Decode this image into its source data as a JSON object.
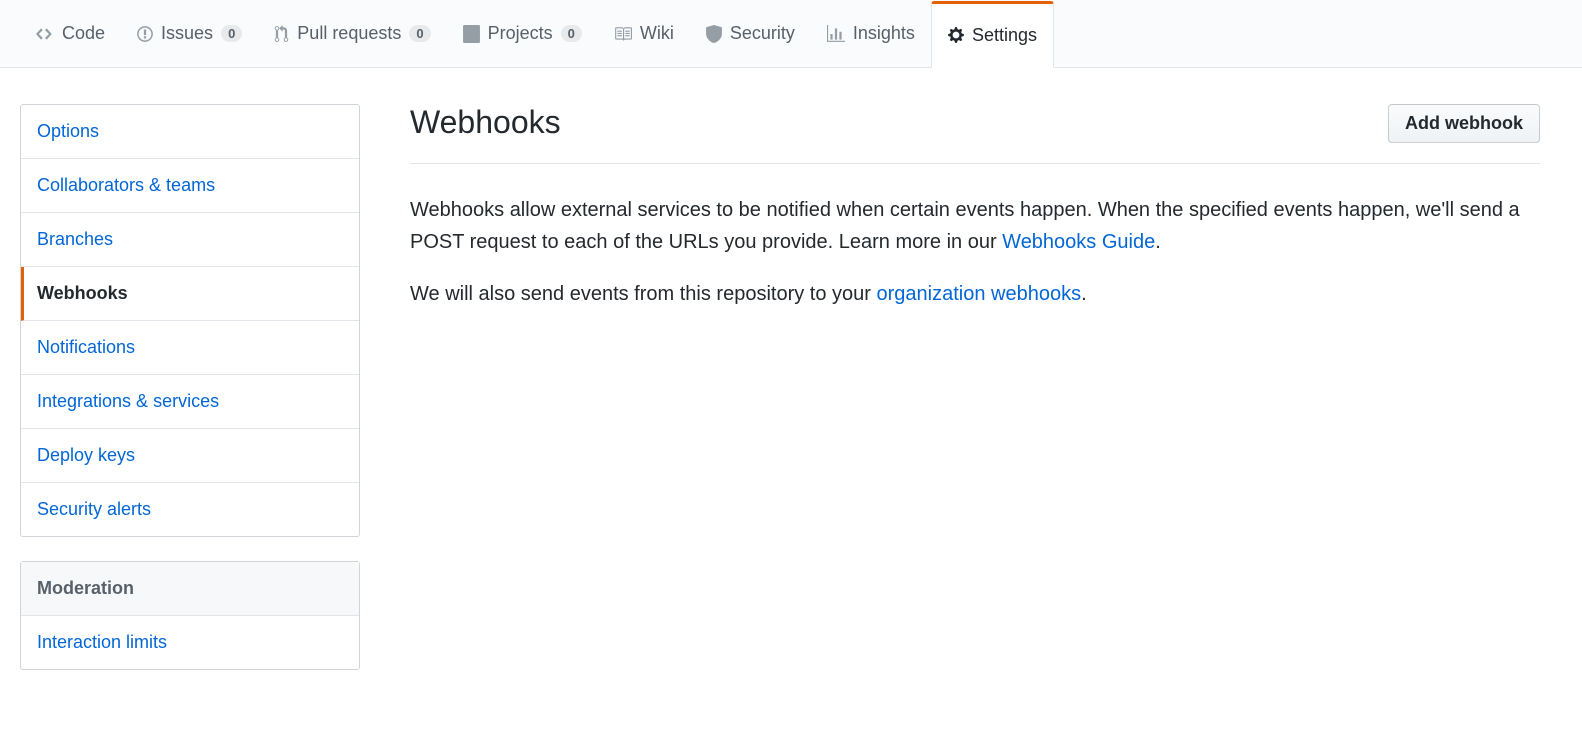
{
  "nav": {
    "code": "Code",
    "issues": "Issues",
    "issues_count": "0",
    "pull_requests": "Pull requests",
    "pull_requests_count": "0",
    "projects": "Projects",
    "projects_count": "0",
    "wiki": "Wiki",
    "security": "Security",
    "insights": "Insights",
    "settings": "Settings"
  },
  "sidebar": {
    "options": "Options",
    "collaborators": "Collaborators & teams",
    "branches": "Branches",
    "webhooks": "Webhooks",
    "notifications": "Notifications",
    "integrations": "Integrations & services",
    "deploy_keys": "Deploy keys",
    "security_alerts": "Security alerts",
    "moderation_heading": "Moderation",
    "interaction_limits": "Interaction limits"
  },
  "main": {
    "title": "Webhooks",
    "add_button": "Add webhook",
    "desc1_a": "Webhooks allow external services to be notified when certain events happen. When the specified events happen, we'll send a POST request to each of the URLs you provide. Learn more in our ",
    "desc1_link": "Webhooks Guide",
    "desc1_b": ".",
    "desc2_a": "We will also send events from this repository to your ",
    "desc2_link": "organization webhooks",
    "desc2_b": "."
  }
}
